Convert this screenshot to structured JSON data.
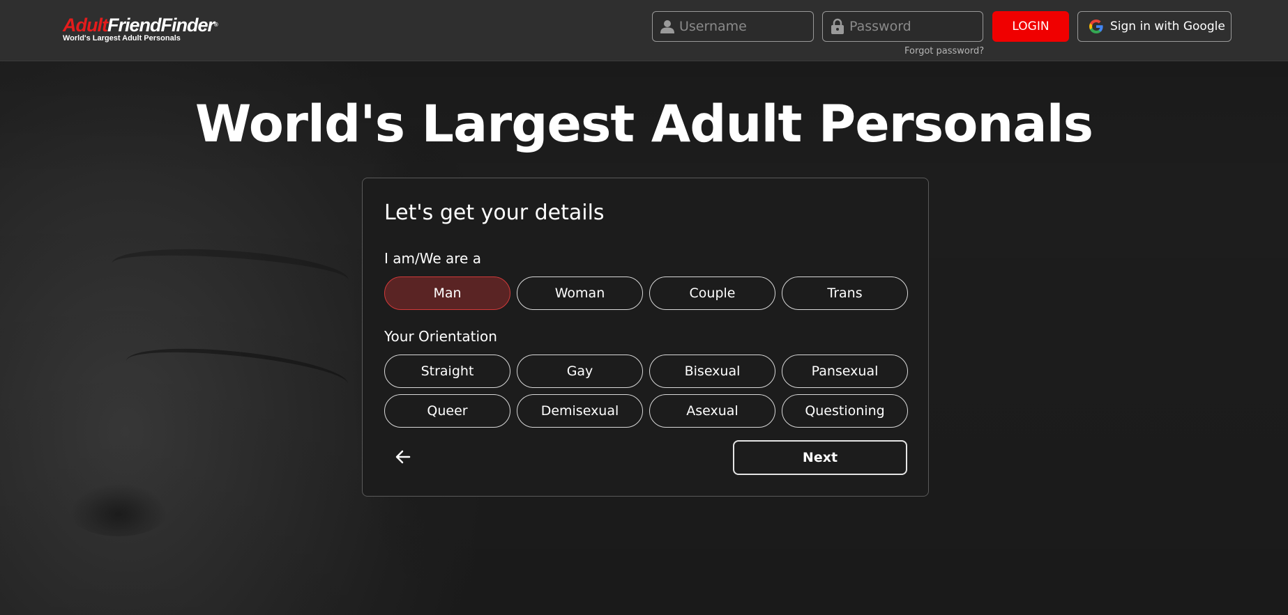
{
  "header": {
    "logo": {
      "part1": "Adult",
      "part2": "FriendFinder",
      "registered": "®",
      "tagline": "World's Largest Adult Personals"
    },
    "username_placeholder": "Username",
    "password_placeholder": "Password",
    "forgot_password": "Forgot password?",
    "login_label": "LOGIN",
    "google_label": "Sign in with Google",
    "icons": {
      "user": "user-icon",
      "lock": "lock-icon",
      "google": "google-icon"
    }
  },
  "hero": {
    "title": "World's Largest Adult Personals"
  },
  "card": {
    "title": "Let's get your details",
    "identity": {
      "label": "I am/We are a",
      "options": [
        "Man",
        "Woman",
        "Couple",
        "Trans"
      ],
      "selected": "Man"
    },
    "orientation": {
      "label": "Your Orientation",
      "options": [
        "Straight",
        "Gay",
        "Bisexual",
        "Pansexual",
        "Queer",
        "Demisexual",
        "Asexual",
        "Questioning"
      ]
    },
    "back_icon": "arrow-left-icon",
    "next_label": "Next"
  },
  "colors": {
    "brand_red": "#f00000",
    "logo_red": "#e41c1c",
    "selected_bg": "#5a2424",
    "selected_border": "#d23a3a",
    "header_bg": "#2f2f2f",
    "card_bg": "#1c1c1c"
  }
}
